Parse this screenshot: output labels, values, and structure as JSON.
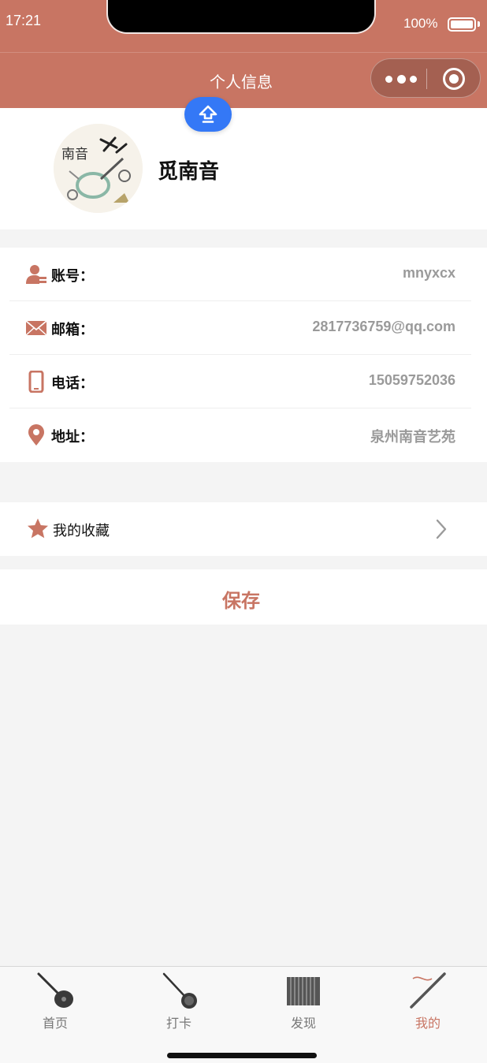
{
  "status_bar": {
    "time": "17:21",
    "battery": "100%"
  },
  "nav": {
    "title": "个人信息",
    "menu_icon": "more-dots-icon",
    "close_icon": "target-circle-icon"
  },
  "floating_button": {
    "icon": "upload-arrow-icon"
  },
  "profile": {
    "name": "觅南音",
    "avatar_text": "南音"
  },
  "info": [
    {
      "label": "账号：",
      "value": "mnyxcx",
      "icon": "user-card-icon"
    },
    {
      "label": "邮箱：",
      "value": "2817736759@qq.com",
      "icon": "mail-icon"
    },
    {
      "label": "电话：",
      "value": "15059752036",
      "icon": "phone-icon"
    },
    {
      "label": "地址：",
      "value": "泉州南音艺苑",
      "icon": "location-pin-icon"
    }
  ],
  "favorites": {
    "label": "我的收藏",
    "icon": "star-icon"
  },
  "save": {
    "label": "保存"
  },
  "tabs": [
    {
      "label": "首页",
      "icon": "pipa-icon",
      "active": false
    },
    {
      "label": "打卡",
      "icon": "sanxian-icon",
      "active": false
    },
    {
      "label": "发现",
      "icon": "paiban-icon",
      "active": false
    },
    {
      "label": "我的",
      "icon": "dongxiao-icon",
      "active": true
    }
  ],
  "colors": {
    "accent": "#c87563",
    "float_button": "#3478f6",
    "value_text": "#9a9a9a"
  }
}
